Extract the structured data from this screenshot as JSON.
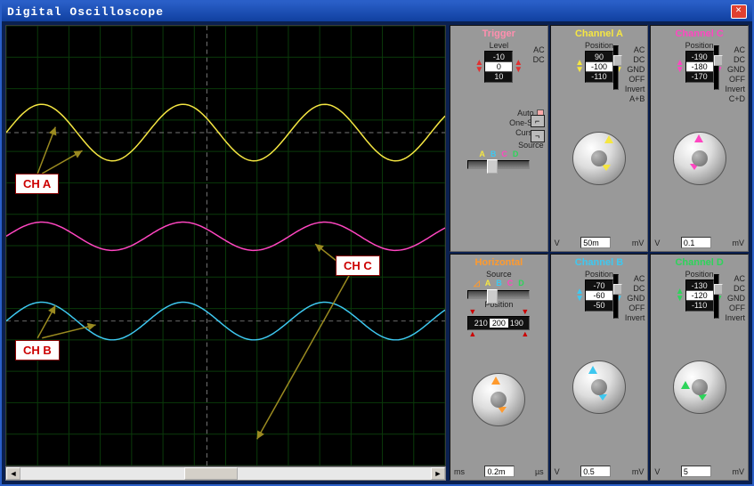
{
  "title": "Digital Oscilloscope",
  "waveform_labels": {
    "a": "CH A",
    "b": "CH B",
    "c": "CH C"
  },
  "trigger": {
    "title": "Trigger",
    "level_label": "Level",
    "ac": "AC",
    "dc": "DC",
    "level_values": [
      "-10",
      "0",
      "10"
    ],
    "auto": "Auto",
    "oneshot": "One-Shot",
    "cursors": "Cursors",
    "source_label": "Source",
    "sources": [
      "A",
      "B",
      "C",
      "D"
    ]
  },
  "horizontal": {
    "title": "Horizontal",
    "source_label": "Source",
    "sources": [
      "A",
      "B",
      "C",
      "D"
    ],
    "position_label": "Position",
    "pos_values": [
      "210",
      "200",
      "190"
    ],
    "unit_left": "ms",
    "unit_right": "µs",
    "value": "0.2m",
    "ticks": [
      "500",
      "200",
      "100",
      "50",
      "20",
      "10",
      "5",
      "2",
      "1",
      "0.5",
      "0.2",
      "0.1"
    ]
  },
  "channels": {
    "A": {
      "title": "Channel A",
      "color": "#f5e642",
      "position_label": "Position",
      "pos_values": [
        "90",
        "-100",
        "-110"
      ],
      "opts": [
        "AC",
        "DC",
        "GND",
        "OFF",
        "Invert",
        "A+B"
      ],
      "unit_left": "V",
      "unit_right": "mV",
      "value": "50m",
      "ticks": [
        "1",
        "0.5",
        "0.2",
        "0.1",
        "50",
        "20",
        "10",
        "5",
        "2"
      ]
    },
    "B": {
      "title": "Channel B",
      "color": "#3ec8f0",
      "position_label": "Position",
      "pos_values": [
        "-70",
        "-60",
        "-50"
      ],
      "opts": [
        "AC",
        "DC",
        "GND",
        "OFF",
        "Invert"
      ],
      "unit_left": "V",
      "unit_right": "mV",
      "value": "0.5",
      "ticks": [
        "1",
        "0.5",
        "0.2",
        "0.1",
        "50",
        "20",
        "10",
        "5",
        "2"
      ]
    },
    "C": {
      "title": "Channel C",
      "color": "#ff46c1",
      "position_label": "Position",
      "pos_values": [
        "-190",
        "-180",
        "-170"
      ],
      "opts": [
        "AC",
        "DC",
        "GND",
        "OFF",
        "Invert",
        "C+D"
      ],
      "unit_left": "V",
      "unit_right": "mV",
      "value": "0.1",
      "ticks": [
        "1",
        "0.5",
        "0.2",
        "0.1",
        "50",
        "20",
        "10",
        "5",
        "2"
      ]
    },
    "D": {
      "title": "Channel D",
      "color": "#2dd45a",
      "position_label": "Position",
      "pos_values": [
        "-130",
        "-120",
        "-110"
      ],
      "opts": [
        "AC",
        "DC",
        "GND",
        "OFF",
        "Invert"
      ],
      "unit_left": "V",
      "unit_right": "mV",
      "value": "5",
      "ticks": [
        "1",
        "0.5",
        "0.2",
        "0.1",
        "50",
        "20",
        "10",
        "5",
        "2"
      ]
    }
  },
  "chart_data": {
    "type": "line",
    "description": "Four oscilloscope traces on 14x14 grid (50px/div). Annotation arrows point from CH labels to their traces.",
    "x_divisions": 14,
    "y_divisions": 14,
    "series": [
      {
        "name": "CH A",
        "color": "#f5e642",
        "baseline_div_from_top": 3.4,
        "amplitude_div": 0.9,
        "periods": 3.1,
        "waveform": "sine"
      },
      {
        "name": "CH C",
        "color": "#ff46c1",
        "baseline_div_from_top": 6.7,
        "amplitude_div": 0.45,
        "periods": 3.1,
        "waveform": "sine"
      },
      {
        "name": "CH B",
        "color": "#3ec8f0",
        "baseline_div_from_top": 9.4,
        "amplitude_div": 0.6,
        "periods": 3.1,
        "waveform": "sine"
      }
    ],
    "cursor_vertical_div": 6.4,
    "baseline_markers_div": [
      3.4,
      9.4
    ]
  }
}
